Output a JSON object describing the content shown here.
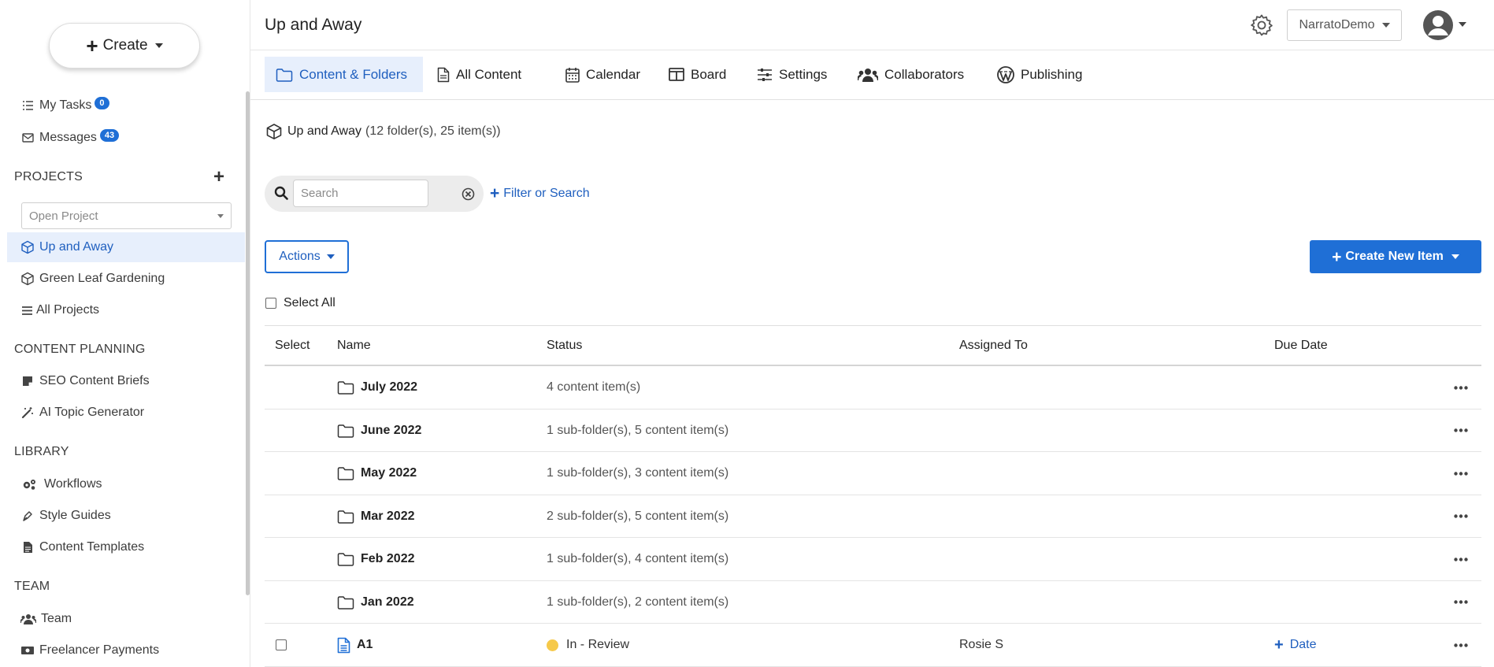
{
  "sidebar": {
    "create_label": "Create",
    "quick_links": [
      {
        "label": "My Tasks",
        "badge": "0",
        "icon": "tasks-list-icon"
      },
      {
        "label": "Messages",
        "badge": "43",
        "icon": "envelope-icon"
      }
    ],
    "projects": {
      "heading": "PROJECTS",
      "open_project_placeholder": "Open Project",
      "items": [
        {
          "label": "Up and Away",
          "icon": "cube-icon",
          "active": true
        },
        {
          "label": "Green Leaf Gardening",
          "icon": "cube-icon"
        },
        {
          "label": "All Projects",
          "icon": "bars-icon"
        }
      ]
    },
    "content_planning": {
      "heading": "CONTENT PLANNING",
      "items": [
        {
          "label": "SEO Content Briefs",
          "icon": "note-icon"
        },
        {
          "label": "AI Topic Generator",
          "icon": "magic-wand-icon"
        }
      ]
    },
    "library": {
      "heading": "LIBRARY",
      "items": [
        {
          "label": "Workflows",
          "icon": "cogs-icon"
        },
        {
          "label": "Style Guides",
          "icon": "pen-nib-icon"
        },
        {
          "label": "Content Templates",
          "icon": "document-icon"
        }
      ]
    },
    "team": {
      "heading": "TEAM",
      "items": [
        {
          "label": "Team",
          "icon": "users-icon"
        },
        {
          "label": "Freelancer Payments",
          "icon": "money-icon"
        }
      ]
    }
  },
  "header": {
    "title": "Up and Away",
    "account_label": "NarratoDemo"
  },
  "tabs": [
    {
      "label": "Content & Folders",
      "icon": "folder-icon",
      "active": true
    },
    {
      "label": "All Content",
      "icon": "file-icon"
    },
    {
      "label": "Calendar",
      "icon": "calendar-icon"
    },
    {
      "label": "Board",
      "icon": "columns-icon"
    },
    {
      "label": "Settings",
      "icon": "sliders-icon"
    },
    {
      "label": "Collaborators",
      "icon": "users-icon"
    },
    {
      "label": "Publishing",
      "icon": "wordpress-icon"
    }
  ],
  "breadcrumb": {
    "project": "Up and Away",
    "count": "(12 folder(s), 25 item(s))"
  },
  "search": {
    "placeholder": "Search",
    "value": "",
    "filter_label": "Filter or Search"
  },
  "toolbar": {
    "actions_label": "Actions",
    "create_new_label": "Create New Item",
    "select_all_label": "Select All"
  },
  "table": {
    "columns": [
      "Select",
      "Name",
      "Status",
      "Assigned To",
      "Due Date"
    ],
    "folders": [
      {
        "name": "July 2022",
        "status": "4 content item(s)"
      },
      {
        "name": "June 2022",
        "status": "1 sub-folder(s), 5 content item(s)"
      },
      {
        "name": "May 2022",
        "status": "1 sub-folder(s), 3 content item(s)"
      },
      {
        "name": "Mar 2022",
        "status": "2 sub-folder(s), 5 content item(s)"
      },
      {
        "name": "Feb 2022",
        "status": "1 sub-folder(s), 4 content item(s)"
      },
      {
        "name": "Jan 2022",
        "status": "1 sub-folder(s), 2 content item(s)"
      }
    ],
    "items": [
      {
        "name": "A1",
        "status": "In - Review",
        "status_color": "#f6c94a",
        "assigned_to": "Rosie S",
        "due_label": "Date"
      }
    ]
  },
  "colors": {
    "accent": "#1f6fd6",
    "active_bg": "#e7effc"
  }
}
